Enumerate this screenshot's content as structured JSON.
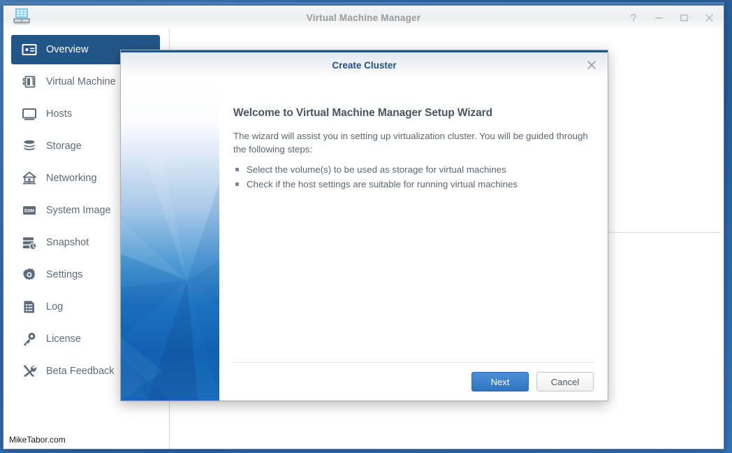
{
  "window": {
    "title": "Virtual Machine Manager",
    "app_icon": "server-rack-icon",
    "controls": {
      "help": "?",
      "minimize": "minimize",
      "maximize": "maximize",
      "close": "close"
    }
  },
  "sidebar": {
    "items": [
      {
        "label": "Overview",
        "icon": "overview-card-icon",
        "active": true
      },
      {
        "label": "Virtual Machine",
        "icon": "virtual-machine-icon",
        "active": false
      },
      {
        "label": "Hosts",
        "icon": "monitor-icon",
        "active": false
      },
      {
        "label": "Storage",
        "icon": "database-stack-icon",
        "active": false
      },
      {
        "label": "Networking",
        "icon": "network-house-icon",
        "active": false
      },
      {
        "label": "System Image",
        "icon": "dsm-image-icon",
        "active": false
      },
      {
        "label": "Snapshot",
        "icon": "snapshot-icon",
        "active": false
      },
      {
        "label": "Settings",
        "icon": "gear-icon",
        "active": false
      },
      {
        "label": "Log",
        "icon": "log-document-icon",
        "active": false
      },
      {
        "label": "License",
        "icon": "key-icon",
        "active": false
      },
      {
        "label": "Beta Feedback",
        "icon": "tools-icon",
        "active": false
      }
    ],
    "watermark": "MikeTabor.com"
  },
  "dialog": {
    "title": "Create Cluster",
    "close_label": "close",
    "heading": "Welcome to Virtual Machine Manager Setup Wizard",
    "paragraph": "The wizard will assist you in setting up virtualization cluster. You will be guided through the following steps:",
    "steps": [
      "Select the volume(s) to be used as storage for virtual machines",
      "Check if the host settings are suitable for running virtual machines"
    ],
    "buttons": {
      "next": "Next",
      "cancel": "Cancel"
    }
  },
  "colors": {
    "accent_blue": "#235688",
    "primary_button": "#2f74c0",
    "title_gray": "#9b9b9b",
    "dialog_title": "#1f4f7d",
    "desktop": "#2f6eb5"
  }
}
